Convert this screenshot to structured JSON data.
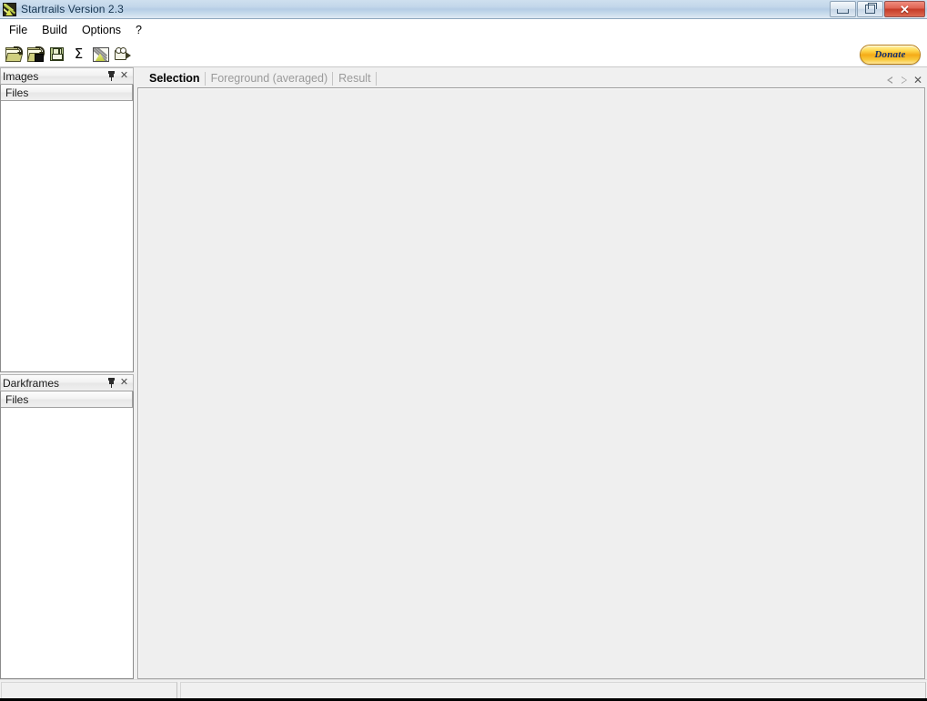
{
  "window": {
    "title": "Startrails Version 2.3",
    "icon": "startrails-app-icon",
    "buttons": {
      "minimize": "minimize-button",
      "maximize": "restore-button",
      "close": "✕"
    }
  },
  "menu": {
    "items": [
      {
        "label": "File"
      },
      {
        "label": "Build"
      },
      {
        "label": "Options"
      },
      {
        "label": "?"
      }
    ]
  },
  "toolbar": {
    "buttons": [
      {
        "name": "open-images-folder",
        "icon": "open-folder-icon",
        "tooltip": "Open images"
      },
      {
        "name": "open-darkframes-folder",
        "icon": "open-folder-dark-icon",
        "tooltip": "Open darkframes"
      },
      {
        "name": "save",
        "icon": "save-floppy-icon",
        "tooltip": "Save"
      },
      {
        "name": "build-sum",
        "icon": "sigma-icon",
        "glyph": "Σ",
        "tooltip": "Build"
      },
      {
        "name": "startrails",
        "icon": "startrails-image-icon",
        "tooltip": "Startrails"
      },
      {
        "name": "video",
        "icon": "video-camera-icon",
        "tooltip": "Video"
      }
    ],
    "donate": {
      "label": "Donate",
      "color": "#f5ab17",
      "text_color": "#12306e"
    }
  },
  "left_dock": {
    "panels": [
      {
        "name": "images",
        "title": "Images",
        "pin": "pin-icon",
        "close": "✕",
        "list": {
          "columns": [
            "Files"
          ],
          "rows": []
        }
      },
      {
        "name": "darkframes",
        "title": "Darkframes",
        "pin": "pin-icon",
        "close": "✕",
        "list": {
          "columns": [
            "Files"
          ],
          "rows": []
        }
      }
    ]
  },
  "main": {
    "tabs": [
      {
        "label": "Selection",
        "active": true
      },
      {
        "label": "Foreground (averaged)",
        "active": false
      },
      {
        "label": "Result",
        "active": false
      }
    ],
    "tab_nav": {
      "prev": "scroll-left-arrow",
      "next": "scroll-right-arrow",
      "close": "✕"
    },
    "content": ""
  },
  "statusbar": {
    "panes": [
      {
        "name": "status-pane-left",
        "text": ""
      },
      {
        "name": "status-pane-right",
        "text": ""
      }
    ]
  }
}
